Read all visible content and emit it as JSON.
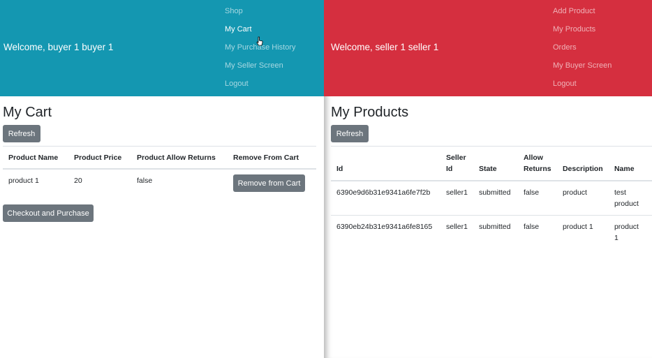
{
  "buyer": {
    "welcome": "Welcome, buyer 1 buyer 1",
    "nav": [
      "Shop",
      "My Cart",
      "My Purchase History",
      "My Seller Screen",
      "Logout"
    ],
    "active_index": 1,
    "title": "My Cart",
    "refresh_label": "Refresh",
    "columns": [
      "Product Name",
      "Product Price",
      "Product Allow Returns",
      "Remove From Cart"
    ],
    "rows": [
      {
        "name": "product 1",
        "price": "20",
        "allow_returns": "false",
        "remove_label": "Remove from Cart"
      }
    ],
    "checkout_label": "Checkout and Purchase",
    "header_color": "#1497b1"
  },
  "seller": {
    "welcome": "Welcome, seller 1 seller 1",
    "nav": [
      "Add Product",
      "My Products",
      "Orders",
      "My Buyer Screen",
      "Logout"
    ],
    "title": "My Products",
    "refresh_label": "Refresh",
    "columns": [
      "Id",
      "Seller Id",
      "State",
      "Allow Returns",
      "Description",
      "Name"
    ],
    "rows": [
      {
        "id": "6390e9d6b31e9341a6fe7f2b",
        "seller_id": "seller1",
        "state": "submitted",
        "allow_returns": "false",
        "description": "product",
        "name": "test product"
      },
      {
        "id": "6390eb24b31e9341a6fe8165",
        "seller_id": "seller1",
        "state": "submitted",
        "allow_returns": "false",
        "description": "product 1",
        "name": "product 1"
      }
    ],
    "header_color": "#d52f3f"
  }
}
